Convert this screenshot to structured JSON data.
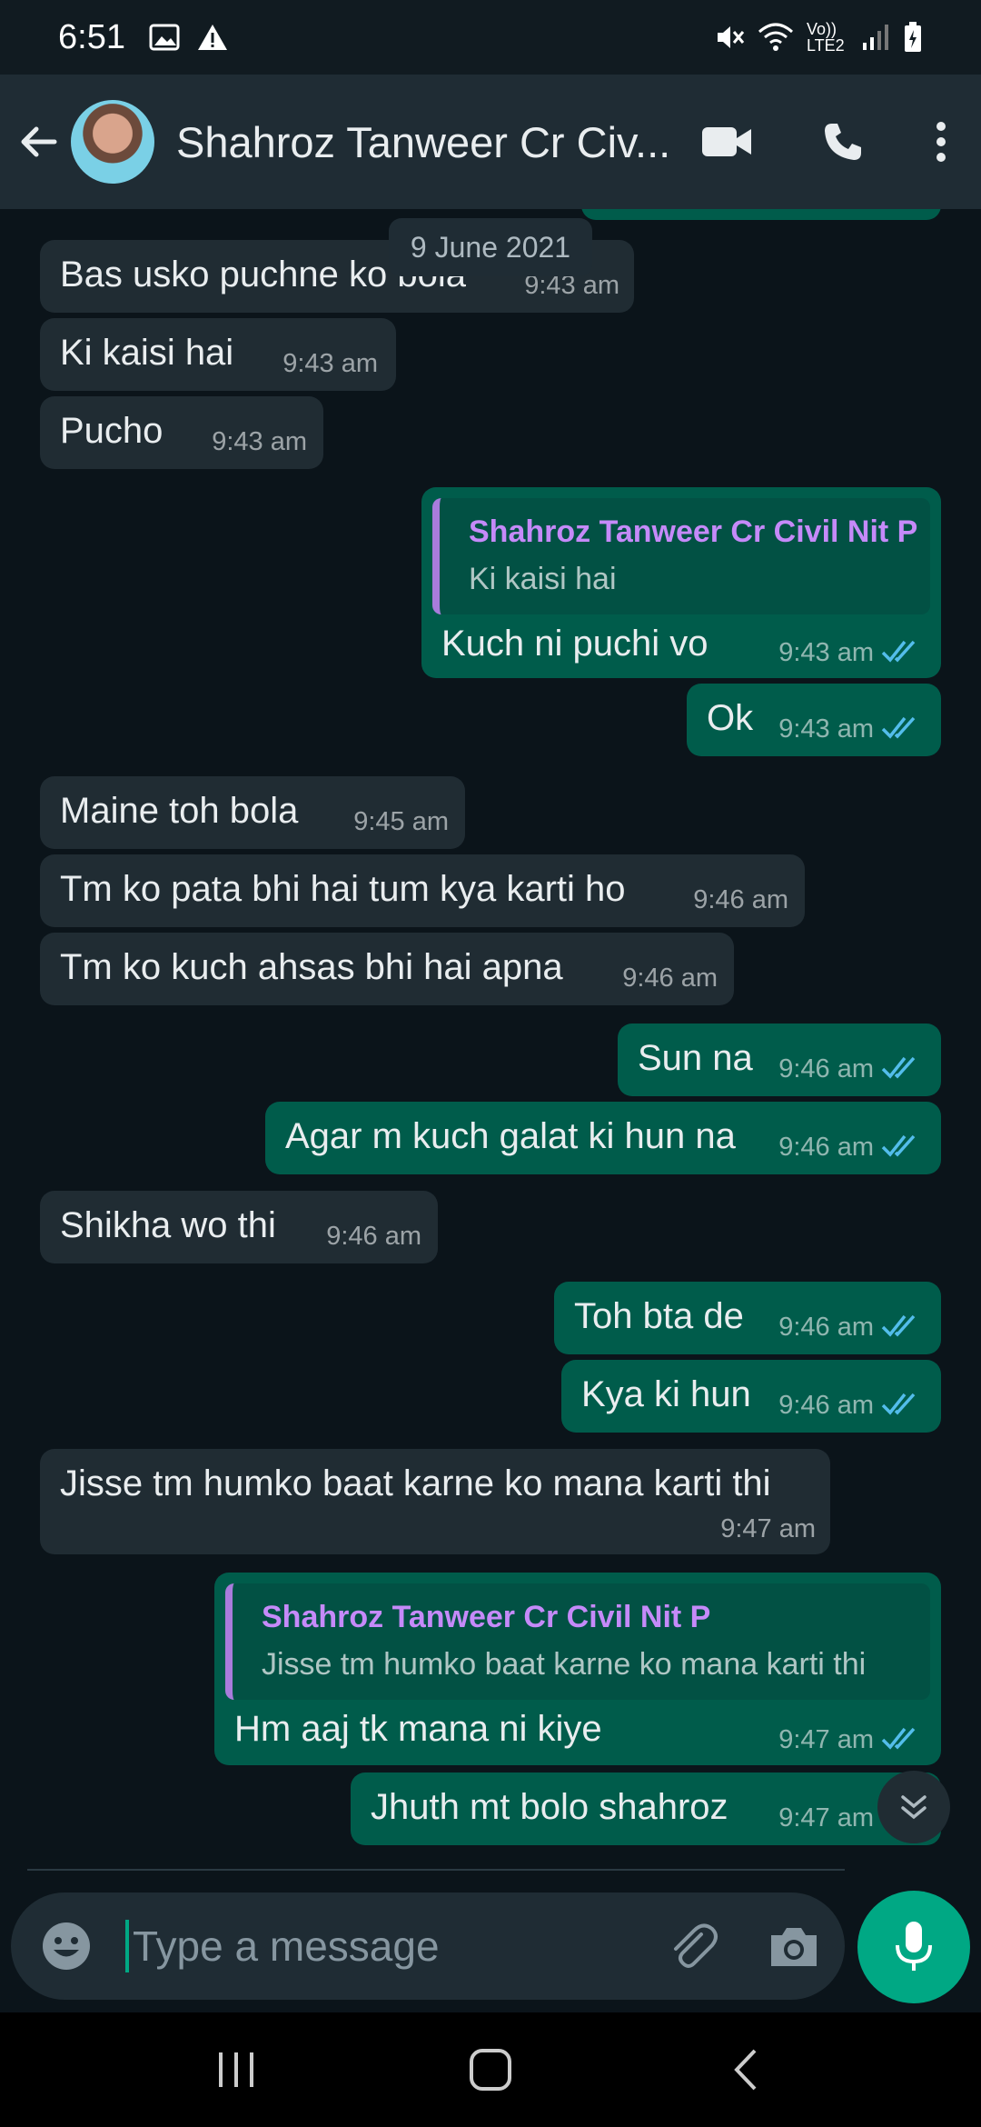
{
  "status_bar": {
    "time": "6:51",
    "network_label": "Vo)) LTE2",
    "icons": [
      "image-icon",
      "warning-icon",
      "mute-icon",
      "wifi-icon",
      "signal-icon",
      "battery-icon"
    ]
  },
  "header": {
    "contact_name": "Shahroz Tanweer Cr Civ...",
    "icons": [
      "back-arrow-icon",
      "video-call-icon",
      "voice-call-icon",
      "more-options-icon"
    ]
  },
  "chat": {
    "date_label": "9 June 2021",
    "messages": [
      {
        "direction": "in",
        "text": "Bas usko puchne ko bola",
        "time": "9:43 am"
      },
      {
        "direction": "in",
        "text": "Ki kaisi hai",
        "time": "9:43 am"
      },
      {
        "direction": "in",
        "text": "Pucho",
        "time": "9:43 am"
      },
      {
        "direction": "out",
        "quote_name": "Shahroz Tanweer Cr Civil Nit P",
        "quote_text": "Ki kaisi hai",
        "text": "Kuch ni puchi vo",
        "time": "9:43 am",
        "status": "read"
      },
      {
        "direction": "out",
        "text": "Ok",
        "time": "9:43 am",
        "status": "read"
      },
      {
        "direction": "in",
        "text": "Maine toh bola",
        "time": "9:45 am"
      },
      {
        "direction": "in",
        "text": "Tm ko pata bhi hai tum kya karti ho",
        "time": "9:46 am"
      },
      {
        "direction": "in",
        "text": "Tm ko kuch ahsas bhi hai apna",
        "time": "9:46 am"
      },
      {
        "direction": "out",
        "text": "Sun na",
        "time": "9:46 am",
        "status": "read"
      },
      {
        "direction": "out",
        "text": "Agar m kuch galat ki hun na",
        "time": "9:46 am",
        "status": "read"
      },
      {
        "direction": "in",
        "text": "Shikha wo thi",
        "time": "9:46 am"
      },
      {
        "direction": "out",
        "text": "Toh bta de",
        "time": "9:46 am",
        "status": "read"
      },
      {
        "direction": "out",
        "text": "Kya ki hun",
        "time": "9:46 am",
        "status": "read"
      },
      {
        "direction": "in",
        "text": "Jisse tm humko baat karne ko mana karti thi",
        "time": "9:47 am"
      },
      {
        "direction": "out",
        "quote_name": "Shahroz Tanweer Cr Civil Nit P",
        "quote_text": "Jisse tm humko baat karne ko mana karti thi",
        "text": "Hm aaj tk mana ni kiye",
        "time": "9:47 am",
        "status": "read"
      },
      {
        "direction": "out",
        "text": "Jhuth mt bolo shahroz",
        "time": "9:47 am",
        "status": "read"
      }
    ]
  },
  "composer": {
    "placeholder": "Type a message",
    "icons": [
      "emoji-icon",
      "attach-icon",
      "camera-icon",
      "mic-icon"
    ]
  },
  "colors": {
    "incoming_bubble": "#202c33",
    "outgoing_bubble": "#005c4b",
    "accent": "#00a884",
    "read_ticks": "#53bdeb",
    "quote_name": "#c58af9"
  }
}
